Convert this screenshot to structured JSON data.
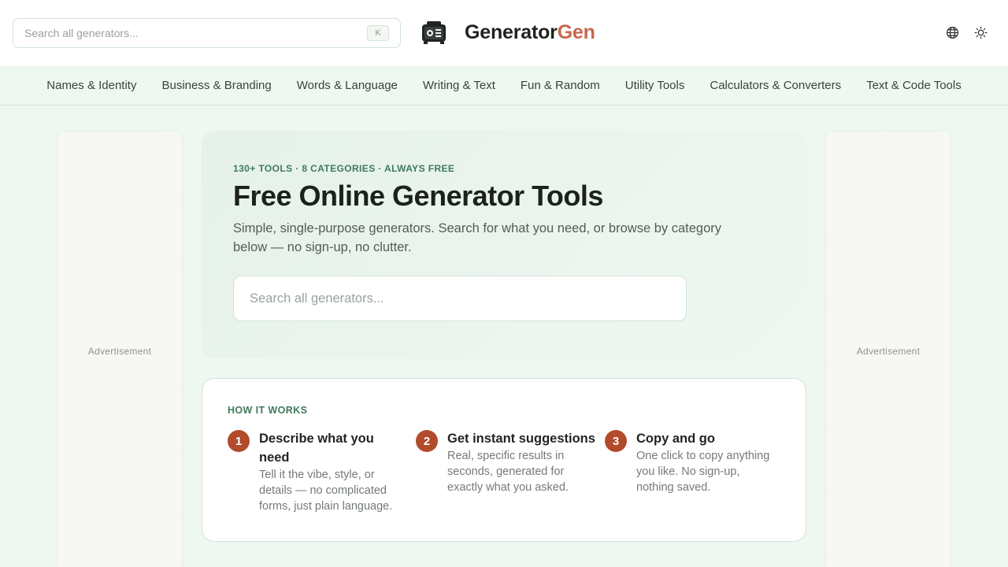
{
  "header": {
    "search_placeholder": "Search all generators...",
    "shortcut_key": "K",
    "brand_part1": "Generator",
    "brand_part2": "Gen",
    "icons": [
      "generator-logo-icon",
      "globe-icon",
      "sun-icon"
    ]
  },
  "nav": {
    "items": [
      {
        "label": "Names & Identity"
      },
      {
        "label": "Business & Branding"
      },
      {
        "label": "Words & Language"
      },
      {
        "label": "Writing & Text"
      },
      {
        "label": "Fun & Random"
      },
      {
        "label": "Utility Tools"
      },
      {
        "label": "Calculators & Converters"
      },
      {
        "label": "Text & Code Tools"
      }
    ]
  },
  "ads": {
    "left_label": "Advertisement",
    "right_label": "Advertisement"
  },
  "hero": {
    "eyebrow": "130+ TOOLS · 8 CATEGORIES · ALWAYS FREE",
    "title": "Free Online Generator Tools",
    "subtitle": "Simple, single-purpose generators. Search for what you need, or browse by category below — no sign-up, no clutter.",
    "search_placeholder": "Search all generators..."
  },
  "how_it_works": {
    "heading": "HOW IT WORKS",
    "steps": [
      {
        "number": "1",
        "title": "Describe what you need",
        "description": "Tell it the vibe, style, or details — no complicated forms, just plain language."
      },
      {
        "number": "2",
        "title": "Get instant suggestions",
        "description": "Real, specific results in seconds, generated for exactly what you asked."
      },
      {
        "number": "3",
        "title": "Copy and go",
        "description": "One click to copy anything you like. No sign-up, nothing saved."
      }
    ]
  },
  "colors": {
    "accent_green": "#3e7a5a",
    "brand_orange": "#c8674c",
    "step_badge": "#b24a2c",
    "page_bg": "#eff7f1"
  }
}
